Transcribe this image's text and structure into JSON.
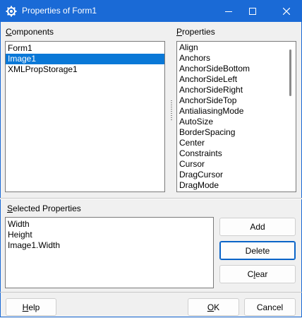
{
  "window": {
    "title": "Properties of Form1"
  },
  "components": {
    "label_accel": "C",
    "label_rest": "omponents",
    "items": [
      "Form1",
      "Image1",
      "XMLPropStorage1"
    ],
    "selected_index": 1
  },
  "properties": {
    "label_accel": "P",
    "label_rest": "roperties",
    "items": [
      "Align",
      "Anchors",
      "AnchorSideBottom",
      "AnchorSideLeft",
      "AnchorSideRight",
      "AnchorSideTop",
      "AntialiasingMode",
      "AutoSize",
      "BorderSpacing",
      "Center",
      "Constraints",
      "Cursor",
      "DragCursor",
      "DragMode"
    ]
  },
  "selected_properties": {
    "label_accel": "S",
    "label_rest": "elected Properties",
    "items": [
      "Width",
      "Height",
      "Image1.Width"
    ]
  },
  "buttons": {
    "add": "Add",
    "delete": "Delete",
    "clear_accel": "l",
    "clear_pre": "C",
    "clear_post": "ear",
    "help_accel": "H",
    "help_rest": "elp",
    "ok_accel": "O",
    "ok_rest": "K",
    "cancel": "Cancel"
  }
}
